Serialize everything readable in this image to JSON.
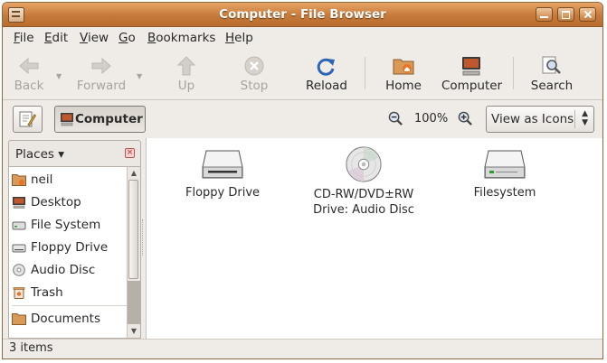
{
  "window": {
    "title": "Computer - File Browser"
  },
  "menubar": [
    "File",
    "Edit",
    "View",
    "Go",
    "Bookmarks",
    "Help"
  ],
  "toolbar": {
    "back": "Back",
    "forward": "Forward",
    "up": "Up",
    "stop": "Stop",
    "reload": "Reload",
    "home": "Home",
    "computer": "Computer",
    "search": "Search"
  },
  "location": {
    "current": "Computer",
    "zoom": "100%",
    "view_mode": "View as Icons"
  },
  "sidebar": {
    "header": "Places",
    "items": [
      {
        "label": "neil",
        "icon": "home-folder-icon"
      },
      {
        "label": "Desktop",
        "icon": "desktop-icon"
      },
      {
        "label": "File System",
        "icon": "harddisk-icon"
      },
      {
        "label": "Floppy Drive",
        "icon": "floppy-icon"
      },
      {
        "label": "Audio Disc",
        "icon": "cd-icon"
      },
      {
        "label": "Trash",
        "icon": "trash-icon"
      },
      {
        "label": "Documents",
        "icon": "folder-icon"
      }
    ]
  },
  "files": [
    {
      "label": "Floppy Drive",
      "icon": "floppy-drive-icon"
    },
    {
      "label": "CD-RW/DVD±RW Drive: Audio Disc",
      "line1": "CD-RW/DVD±RW",
      "line2": "Drive: Audio Disc",
      "icon": "cd-drive-icon"
    },
    {
      "label": "Filesystem",
      "icon": "harddisk-icon"
    }
  ],
  "status": {
    "text": "3 items"
  },
  "colors": {
    "titlebar": "#c67a3a",
    "window_bg": "#efebe7",
    "accent": "#e07a2a"
  }
}
